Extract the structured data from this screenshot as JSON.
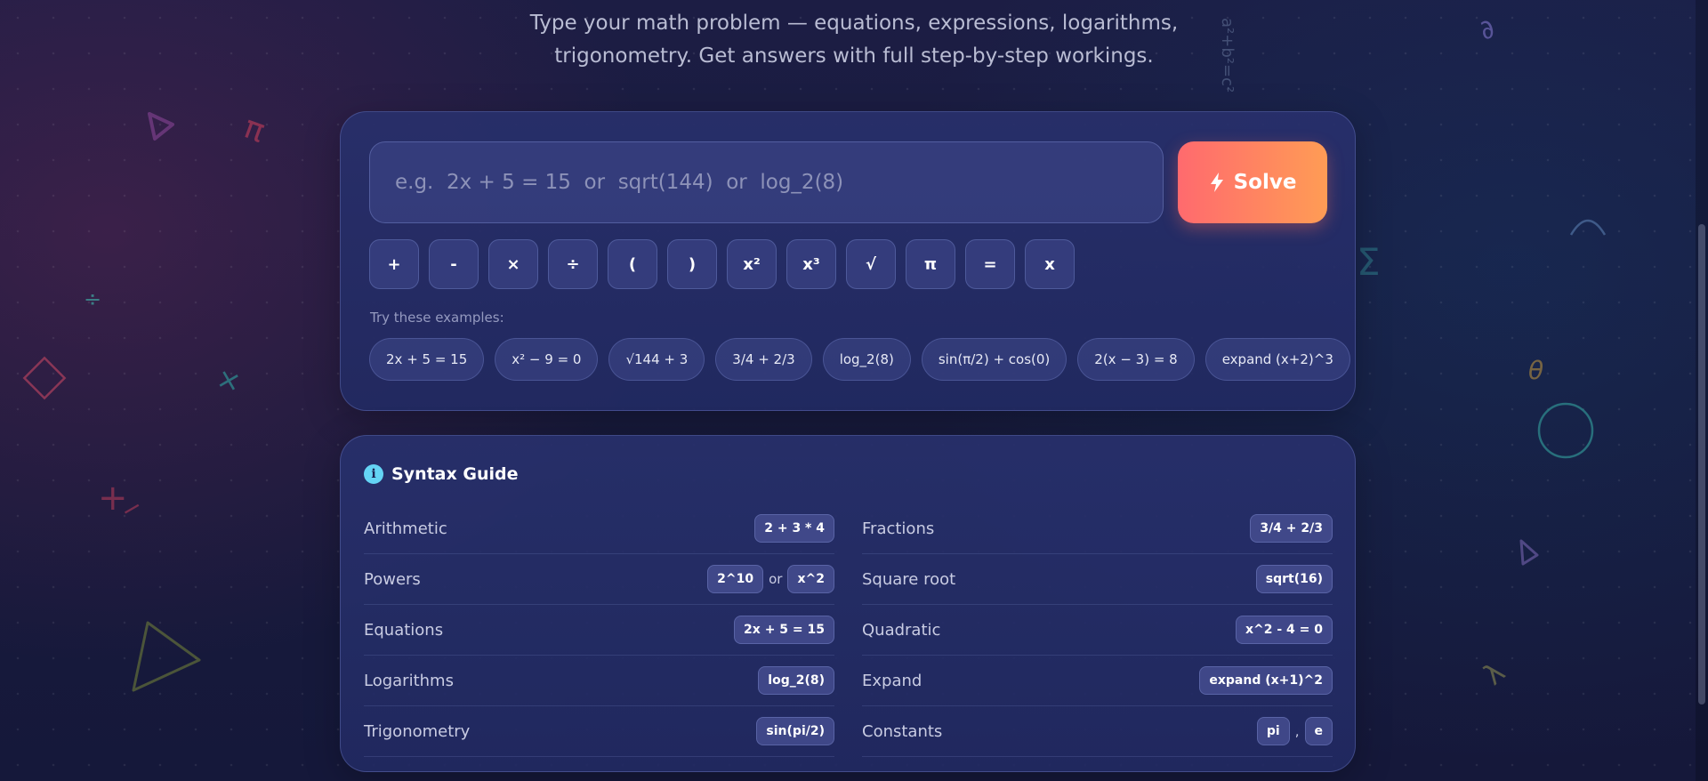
{
  "header": {
    "subtitle_line1": "Type your math problem — equations, expressions, logarithms,",
    "subtitle_line2": "trigonometry. Get answers with full step-by-step workings."
  },
  "solver": {
    "input_value": "",
    "input_placeholder": "e.g.  2x + 5 = 15  or  sqrt(144)  or  log_2(8)",
    "solve_label": "Solve",
    "keys": [
      "+",
      "-",
      "×",
      "÷",
      "(",
      ")",
      "x²",
      "x³",
      "√",
      "π",
      "=",
      "x"
    ],
    "examples_label": "Try these examples:",
    "examples": [
      "2x + 5 = 15",
      "x² − 9 = 0",
      "√144 + 3",
      "3/4 + 2/3",
      "log_2(8)",
      "sin(π/2) + cos(0)",
      "2(x − 3) = 8",
      "expand (x+2)^3"
    ]
  },
  "guide": {
    "title": "Syntax Guide",
    "left": [
      {
        "label": "Arithmetic",
        "codes": [
          "2 + 3 * 4"
        ],
        "sep": ""
      },
      {
        "label": "Powers",
        "codes": [
          "2^10",
          "x^2"
        ],
        "sep": "or"
      },
      {
        "label": "Equations",
        "codes": [
          "2x + 5 = 15"
        ],
        "sep": ""
      },
      {
        "label": "Logarithms",
        "codes": [
          "log_2(8)"
        ],
        "sep": ""
      },
      {
        "label": "Trigonometry",
        "codes": [
          "sin(pi/2)"
        ],
        "sep": ""
      }
    ],
    "right": [
      {
        "label": "Fractions",
        "codes": [
          "3/4 + 2/3"
        ],
        "sep": ""
      },
      {
        "label": "Square root",
        "codes": [
          "sqrt(16)"
        ],
        "sep": ""
      },
      {
        "label": "Quadratic",
        "codes": [
          "x^2 - 4 = 0"
        ],
        "sep": ""
      },
      {
        "label": "Expand",
        "codes": [
          "expand (x+1)^2"
        ],
        "sep": ""
      },
      {
        "label": "Constants",
        "codes": [
          "pi",
          "e"
        ],
        "sep": ","
      }
    ]
  },
  "decor": {
    "symbols": [
      "π",
      "÷",
      "×",
      "+",
      "−",
      "Σ",
      "θ",
      "∂",
      "λ",
      "a²+b²=c²"
    ],
    "accent_pink": "#e0506e",
    "accent_teal": "#3fd0c8",
    "accent_orange": "#ff9c55",
    "accent_purple": "#8a7cd8"
  },
  "icons": {
    "solve": "bolt-icon",
    "guide": "info-icon",
    "info_glyph": "i"
  }
}
